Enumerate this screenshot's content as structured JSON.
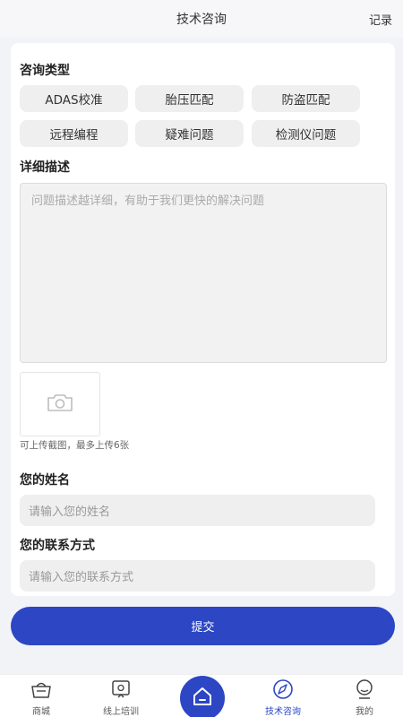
{
  "header": {
    "title": "技术咨询",
    "record": "记录"
  },
  "consult_type": {
    "label": "咨询类型",
    "options": [
      "ADAS校准",
      "胎压匹配",
      "防盗匹配",
      "远程编程",
      "疑难问题",
      "检测仪问题"
    ]
  },
  "detail": {
    "label": "详细描述",
    "placeholder": "问题描述越详细，有助于我们更快的解决问题"
  },
  "upload": {
    "hint": "可上传截图，最多上传6张",
    "icon": "camera-icon"
  },
  "name": {
    "label": "您的姓名",
    "placeholder": "请输入您的姓名"
  },
  "contact": {
    "label": "您的联系方式",
    "placeholder": "请输入您的联系方式"
  },
  "submit_label": "提交",
  "tabs": [
    {
      "label": "商城",
      "icon": "shop-basket-icon"
    },
    {
      "label": "线上培训",
      "icon": "training-icon"
    },
    {
      "label": "",
      "icon": "home-icon"
    },
    {
      "label": "技术咨询",
      "icon": "compass-icon"
    },
    {
      "label": "我的",
      "icon": "profile-icon"
    }
  ],
  "colors": {
    "accent": "#2c46c4",
    "chip_bg": "#efefef",
    "page_bg": "#f2f3f7"
  }
}
